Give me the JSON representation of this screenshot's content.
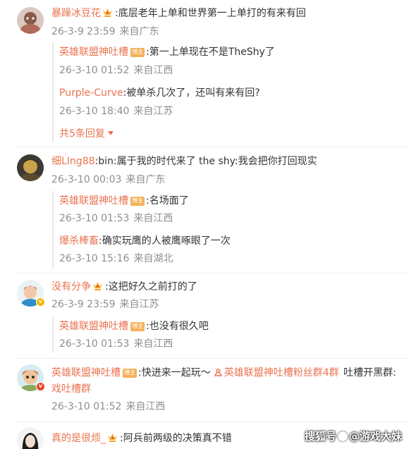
{
  "colors": {
    "username": "#eb7350",
    "meta": "#8e8e8e",
    "text": "#333333",
    "crown": "#f5a623",
    "tag": "#f5b05a",
    "badge_gold": "#f7b500",
    "badge_red": "#e8422a"
  },
  "icons": {
    "crown": "crown-icon",
    "fan_group": "fan-group-icon",
    "expand": "caret-down-icon",
    "watermark": "paw-icon"
  },
  "comments": [
    {
      "user": "暴躁冰豆花",
      "text": ":底层老年上单和世界第一上单打的有来有回",
      "date": "26-3-9 23:59",
      "location": "来自广东",
      "replies": [
        {
          "user": "英雄联盟神吐槽",
          "tag": "博主",
          "text": ":第一上单现在不是TheShy了",
          "date": "26-3-10 01:52",
          "location": "来自江西"
        },
        {
          "user": "Purple-Curve",
          "text": ":被单杀几次了，还叫有来有回?",
          "date": "26-3-10 18:40",
          "location": "来自江苏"
        }
      ],
      "more_replies": "共5条回复"
    },
    {
      "user": "细LIng88",
      "text": ":bin:属于我的时代来了 the shy:我会把你打回现实",
      "date": "26-3-10 00:03",
      "location": "来自广东",
      "replies": [
        {
          "user": "英雄联盟神吐槽",
          "tag": "博主",
          "text": ":名场面了",
          "date": "26-3-10 01:53",
          "location": "来自江西"
        },
        {
          "user": "爆杀棒畜",
          "text": ":确实玩鹰的人被鹰啄眼了一次",
          "date": "26-3-10 15:16",
          "location": "来自湖北"
        }
      ]
    },
    {
      "user": "没有分争",
      "text": ":这把好久之前打的了",
      "date": "26-3-9 23:59",
      "location": "来自江苏",
      "replies": [
        {
          "user": "英雄联盟神吐槽",
          "tag": "博主",
          "text": ":也没有很久吧",
          "date": "26-3-10 01:53",
          "location": "来自江西"
        }
      ]
    },
    {
      "user": "英雄联盟神吐槽",
      "tag": "博主",
      "text_a": ":快进来一起玩～",
      "link": "英雄联盟神吐槽粉丝群4群",
      "text_b": "吐槽开黑群:",
      "text_c": "戏吐槽群",
      "date": "26-3-10 01:52",
      "location": "来自江西"
    },
    {
      "user": "真的是很烦_",
      "text": ":阿兵前两级的决策真不错"
    }
  ],
  "watermark": {
    "source": "搜狐号",
    "at": "@",
    "account": "游戏大妹"
  }
}
